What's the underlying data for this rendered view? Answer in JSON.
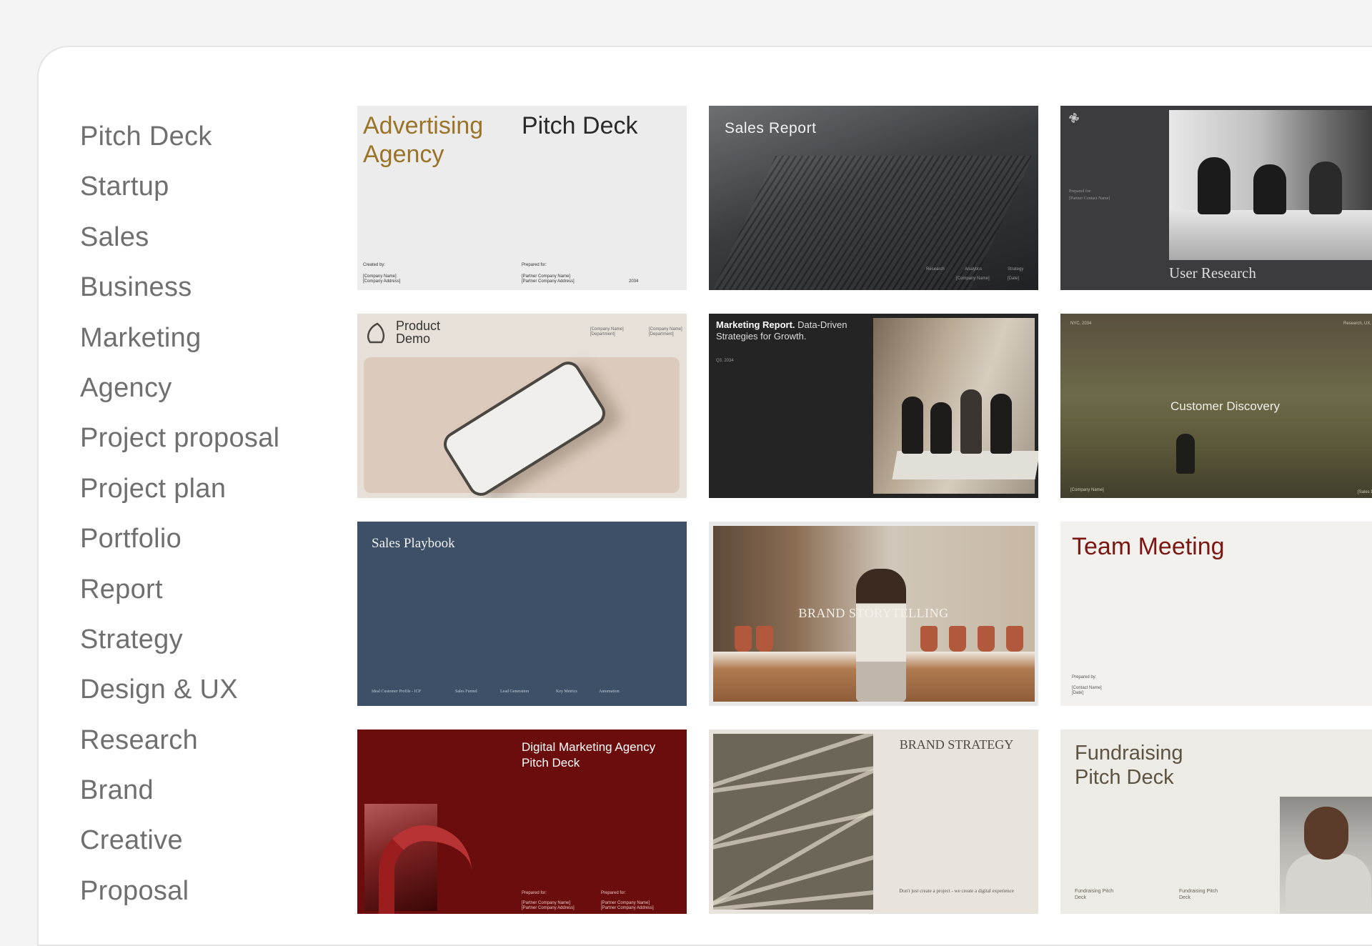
{
  "categories": [
    "Pitch Deck",
    "Startup",
    "Sales",
    "Business",
    "Marketing",
    "Agency",
    "Project proposal",
    "Project plan",
    "Portfolio",
    "Report",
    "Strategy",
    "Design & UX",
    "Research",
    "Brand",
    "Creative",
    "Proposal"
  ],
  "templates": {
    "t1": {
      "title_left": "Advertising Agency",
      "title_right": "Pitch Deck",
      "created_by": "Created by:",
      "company_name": "[Company Name]",
      "company_address": "[Company Address]",
      "prepared_for": "Prepared for:",
      "partner_name": "[Partner Company Name]",
      "partner_address": "[Partner Company Address]",
      "year": "2034"
    },
    "t2": {
      "title": "Sales Report",
      "foot_1": "Research",
      "foot_2": "Analytics",
      "foot_3": "Strategy",
      "foot_4": "[Company Name]",
      "foot_5": "[Date]"
    },
    "t3": {
      "title": "User Research",
      "prepared_for": "Prepared for:",
      "partner_contact": "[Partner Contact Name]"
    },
    "t4": {
      "title": "Product Demo",
      "company_1": "[Company Name]",
      "dept_1": "[Department]",
      "company_2": "[Company Name]",
      "dept_2": "[Department]"
    },
    "t5": {
      "title_bold": "Marketing Report.",
      "title_rest": "Data-Driven Strategies for Growth.",
      "quarter": "Q3, 2034"
    },
    "t6": {
      "title": "Customer Discovery",
      "top_left": "NYC, 2034",
      "top_right": "Research, UX, UI",
      "bottom_left": "[Company Name]",
      "bottom_right": "[Sales Data]"
    },
    "t7": {
      "title": "Sales Playbook",
      "foot_1": "Ideal Customer Profile - ICP",
      "foot_2": "Sales Funnel",
      "foot_3": "Lead Generation",
      "foot_4": "Key Metrics",
      "foot_5": "Automation"
    },
    "t8": {
      "title": "BRAND STORYTELLING"
    },
    "t9": {
      "title": "Team Meeting",
      "prepared_by": "Prepared by:",
      "contact_name": "[Contact Name]",
      "date": "[Date]"
    },
    "t10": {
      "title": "Digital Marketing Agency Pitch Deck",
      "prepared_for_1": "Prepared for:",
      "partner_name_1": "[Partner Company Name]",
      "partner_address_1": "[Partner Company Address]",
      "prepared_for_2": "Prepared for:",
      "partner_name_2": "[Partner Company Name]",
      "partner_address_2": "[Partner Company Address]"
    },
    "t11": {
      "title": "BRAND STRATEGY",
      "foot": "Don't just create a project - we create a digital experience"
    },
    "t12": {
      "title": "Fundraising Pitch Deck",
      "meta_1": "Fundraising Pitch Deck",
      "meta_2": "Fundraising Pitch Deck"
    }
  }
}
